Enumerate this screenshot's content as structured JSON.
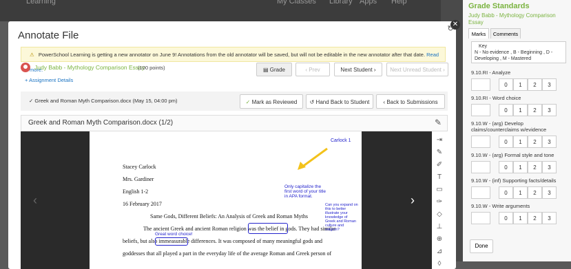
{
  "background": {
    "nav_items": [
      "Learning",
      "My Classes",
      "Library",
      "Apps",
      "Help"
    ]
  },
  "modal": {
    "title": "Annotate File",
    "notice": {
      "text": "PowerSchool Learning is getting a new annotator on June 9! Annotations from the old annotator will be saved, but will not be editable in the new annotator after that date.",
      "link": "Read more."
    },
    "student": {
      "name": "Judy Babb - Mythology Comparison Essay",
      "points": "(100 points)"
    },
    "buttons": {
      "grade": "Grade",
      "prev": "Prev",
      "next": "Next Student",
      "next_unread": "Next Unread Student",
      "mark_reviewed": "Mark as Reviewed",
      "hand_back": "Hand Back to Student",
      "back": "Back to Submissions"
    },
    "assignment_details": "Assignment Details",
    "submission_file": "Greek and Roman Myth Comparison.docx (May 15, 04:00 pm)",
    "doc_title": "Greek and Roman Myth Comparison.docx (1/2)"
  },
  "document": {
    "header_right": "Carlock 1",
    "lines": {
      "name": "Stacey Carlock",
      "teacher": "Mrs. Gardiner",
      "course": "English 1-2",
      "date": "16 February 2017",
      "title": "Same Gods, Different Beliefs: An Analysis of Greek and Roman Myths",
      "p1": "The ancient Greek and ancient Roman religion was the belief in gods. They had similar",
      "p2": "beliefs, but also immeasurable differences. It was composed of many meaningful gods and",
      "p3": "goddesses that all played a part in the everyday life of the average Roman and Greek person of"
    },
    "annotations": {
      "capitalize": "Only capitalize the first word of your title in APA format.",
      "expand": "Can you expand on this to better illustrate your knowledge of Greek and Roman culture and religion?",
      "word_choice": "Great word choice!"
    }
  },
  "panel": {
    "title": "Grade Standards",
    "subtitle": "Judy Babb - Mythology Comparison Essay",
    "tabs": [
      "Marks",
      "Comments"
    ],
    "key_label": "Key",
    "key_text": "N - No evidence , B - Beginning , D - Developing , M - Mastered",
    "standards": [
      {
        "label": "9.10.RI - Analyze",
        "options": [
          "0",
          "1",
          "2",
          "3"
        ]
      },
      {
        "label": "9.10.RI - Word choice",
        "options": [
          "0",
          "1",
          "2",
          "3"
        ]
      },
      {
        "label": "9.10.W - (arg) Develop claims/counterclaims w/evidence",
        "options": [
          "0",
          "1",
          "2",
          "3"
        ]
      },
      {
        "label": "9.10.W - (arg) Formal style and tone",
        "options": [
          "0",
          "1",
          "2",
          "3"
        ]
      },
      {
        "label": "9.10.W - (inf) Supporting facts/details",
        "options": [
          "0",
          "1",
          "2",
          "3"
        ]
      },
      {
        "label": "9.10.W - Write arguments",
        "options": [
          "0",
          "1",
          "2",
          "3"
        ]
      }
    ],
    "done": "Done"
  },
  "colors": {
    "accent_green": "#7ab33f",
    "link_blue": "#1a73c2",
    "annotation_blue": "#2222cc",
    "arrow_yellow": "#f3c21b"
  }
}
